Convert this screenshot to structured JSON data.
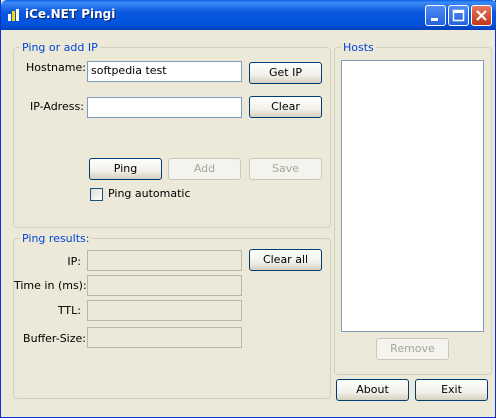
{
  "window": {
    "title": "iCe.NET Pingi"
  },
  "ping_group": {
    "legend": "Ping or add IP",
    "hostname_label": "Hostname:",
    "hostname_value": "softpedia test",
    "ip_label": "IP-Adress:",
    "ip_value": "",
    "get_ip_button": "Get IP",
    "clear_button": "Clear",
    "ping_button": "Ping",
    "add_button": "Add",
    "save_button": "Save",
    "ping_auto_label": "Ping automatic"
  },
  "results_group": {
    "legend": "Ping results:",
    "ip_label": "IP:",
    "ip_value": "",
    "time_label": "Time in (ms):",
    "time_value": "",
    "ttl_label": "TTL:",
    "ttl_value": "",
    "buffer_label": "Buffer-Size:",
    "buffer_value": "",
    "clear_all_button": "Clear all"
  },
  "hosts_group": {
    "legend": "Hosts",
    "items": [],
    "remove_button": "Remove"
  },
  "footer": {
    "about_button": "About",
    "exit_button": "Exit"
  },
  "colors": {
    "titlebar": "#0453dc",
    "group_legend": "#0046d5",
    "window_bg": "#ece9d8"
  }
}
